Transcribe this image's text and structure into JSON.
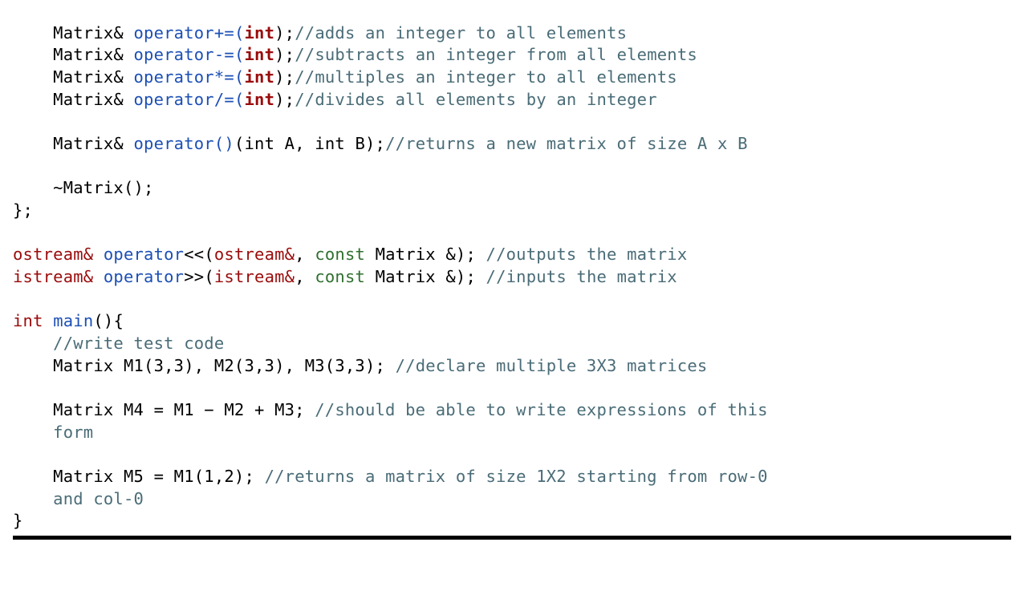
{
  "code": {
    "l1": {
      "pre": "    Matrix& ",
      "op": "operator",
      "sym": "+=(",
      "param": "int",
      "post": ");",
      "cmt": "//adds an integer to all elements"
    },
    "l2": {
      "pre": "    Matrix& ",
      "op": "operator",
      "sym": "-=(",
      "param": "int",
      "post": ");",
      "cmt": "//subtracts an integer from all elements"
    },
    "l3": {
      "pre": "    Matrix& ",
      "op": "operator",
      "sym": "*=(",
      "param": "int",
      "post": ");",
      "cmt": "//multiples an integer to all elements"
    },
    "l4": {
      "pre": "    Matrix& ",
      "op": "operator",
      "sym": "/=(",
      "param": "int",
      "post": ");",
      "cmt": "//divides all elements by an integer"
    },
    "blank1": "",
    "l5": {
      "pre": "    Matrix& ",
      "op": "operator",
      "sym": "()",
      "args": "(int A, int B);",
      "cmt": "//returns a new matrix of size A x B"
    },
    "blank2": "",
    "l6": "    ~Matrix();",
    "l7": "};",
    "blank3": "",
    "l8": {
      "t": "ostream&",
      "sp": " ",
      "op": "operator",
      "sym": "<<(",
      "t2": "ostream&",
      "c": ", ",
      "kw": "const",
      "rest": " Matrix &); ",
      "cmt": "//outputs the matrix"
    },
    "l9": {
      "t": "istream&",
      "sp": " ",
      "op": "operator",
      "sym": ">>(",
      "t2": "istream&",
      "c": ", ",
      "kw": "const",
      "rest": " Matrix &); ",
      "cmt": "//inputs the matrix"
    },
    "blank4": "",
    "l10": {
      "t": "int",
      "sp": " ",
      "fn": "main",
      "rest": "(){"
    },
    "l11": {
      "pre": "    ",
      "cmt": "//write test code"
    },
    "l12": {
      "pre": "    Matrix M1(3,3), M2(3,3), M3(3,3); ",
      "cmt": "//declare multiple 3X3 matrices"
    },
    "blank5": "",
    "l13a": {
      "pre": "    Matrix M4 = M1 − M2 + M3; ",
      "cmt": "//should be able to write expressions of this"
    },
    "l13b": {
      "pre": "    ",
      "cmt": "form"
    },
    "blank6": "",
    "l14a": {
      "pre": "    Matrix M5 = M1(1,2); ",
      "cmt": "//returns a matrix of size 1X2 starting from row-0"
    },
    "l14b": {
      "pre": "    ",
      "cmt": "and col-0"
    },
    "l15": "}"
  }
}
